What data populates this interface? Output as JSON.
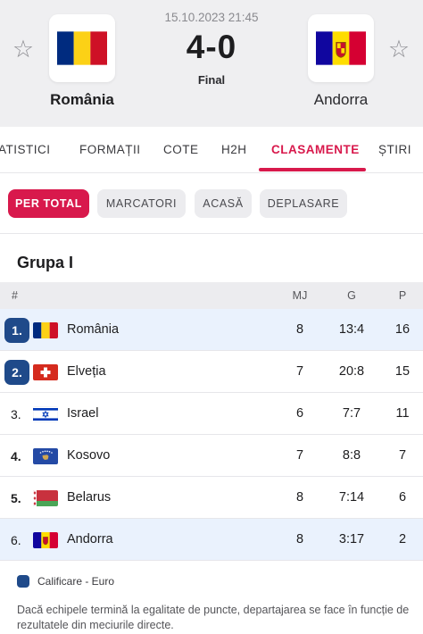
{
  "match": {
    "datetime": "15.10.2023 21:45",
    "score": "4-0",
    "status": "Final",
    "home": {
      "name": "România",
      "flag": "romania-flag-icon"
    },
    "away": {
      "name": "Andorra",
      "flag": "andorra-flag-icon"
    }
  },
  "tabs": [
    {
      "label": "ATISTICI"
    },
    {
      "label": "FORMAȚII"
    },
    {
      "label": "COTE"
    },
    {
      "label": "H2H"
    },
    {
      "label": "CLASAMENTE",
      "active": true
    },
    {
      "label": "ȘTIRI"
    }
  ],
  "filters": [
    {
      "label": "PER TOTAL",
      "active": true
    },
    {
      "label": "MARCATORI"
    },
    {
      "label": "ACASĂ"
    },
    {
      "label": "DEPLASARE"
    }
  ],
  "standings": {
    "group_title": "Grupa I",
    "columns": {
      "rank": "#",
      "mj": "MJ",
      "g": "G",
      "p": "P"
    },
    "rows": [
      {
        "rank": "1.",
        "team": "România",
        "mj": "8",
        "g": "13:4",
        "p": "16",
        "qualified": true
      },
      {
        "rank": "2.",
        "team": "Elveția",
        "mj": "7",
        "g": "20:8",
        "p": "15",
        "qualified": true
      },
      {
        "rank": "3.",
        "team": "Israel",
        "mj": "6",
        "g": "7:7",
        "p": "11"
      },
      {
        "rank": "4.",
        "team": "Kosovo",
        "mj": "7",
        "g": "8:8",
        "p": "7"
      },
      {
        "rank": "5.",
        "team": "Belarus",
        "mj": "8",
        "g": "7:14",
        "p": "6"
      },
      {
        "rank": "6.",
        "team": "Andorra",
        "mj": "8",
        "g": "3:17",
        "p": "2"
      }
    ]
  },
  "legend": {
    "label": "Calificare - Euro",
    "color": "#1f4a8a"
  },
  "note": "Dacă echipele termină la egalitate de puncte, departajarea se face în funcție de rezultatele din meciurile directe.",
  "colors": {
    "accent": "#d8194c",
    "qualified": "#1f4a8a",
    "highlight_row": "#eaf2fd"
  }
}
